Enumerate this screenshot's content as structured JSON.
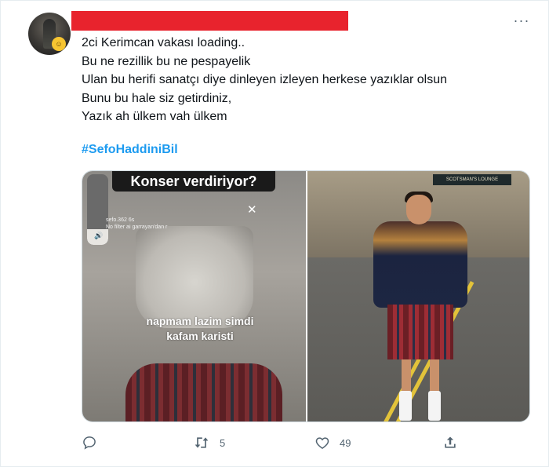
{
  "tweet": {
    "lines": [
      "2ci Kerimcan vakası loading..",
      "Bu ne rezillik bu ne pespayelik",
      "Ulan bu herifi sanatçı diye dinleyen izleyen herkese yazıklar olsun",
      "Bunu bu hale siz getirdiniz,",
      "Yazık ah ülkem vah ülkem"
    ],
    "hashtag": "#SefoHaddiniBil"
  },
  "media": {
    "left": {
      "banner": "Konser verdiriyor?",
      "story_user": "sefo.362",
      "story_time": "6s",
      "story_sub": "No filter ai garrayan'dan r",
      "caption_line1": "napmam lazim simdi",
      "caption_line2": "kafam karisti",
      "volume_level": 0.22
    },
    "right": {
      "sign_text": "SCOTSMAN'S LOUNGE"
    }
  },
  "actions": {
    "retweet_count": "5",
    "like_count": "49"
  },
  "icons": [
    "more-icon",
    "reply-icon",
    "retweet-icon",
    "like-icon",
    "share-icon",
    "volume-icon",
    "close-icon"
  ],
  "colors": {
    "accent": "#1d9bf0",
    "redaction": "#e8232d",
    "text": "#0f1419",
    "muted": "#536471"
  }
}
